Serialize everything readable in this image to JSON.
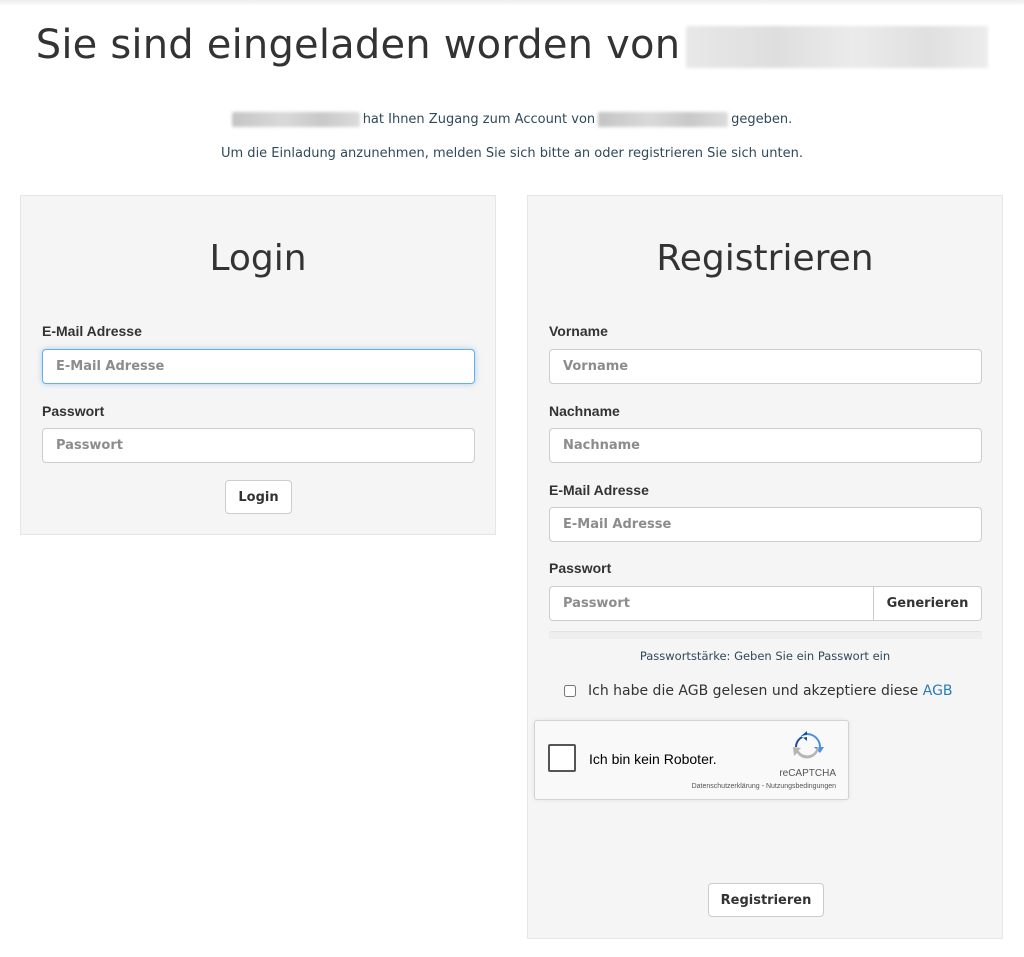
{
  "header": {
    "title": "Sie sind eingeladen worden von",
    "info_access": "hat Ihnen Zugang zum Account von",
    "info_given": "gegeben.",
    "info_instruction": "Um die Einladung anzunehmen, melden Sie sich bitte an oder registrieren Sie sich unten."
  },
  "login": {
    "title": "Login",
    "email_label": "E-Mail Adresse",
    "email_placeholder": "E-Mail Adresse",
    "password_label": "Passwort",
    "password_placeholder": "Passwort",
    "submit_label": "Login"
  },
  "register": {
    "title": "Registrieren",
    "firstname_label": "Vorname",
    "firstname_placeholder": "Vorname",
    "lastname_label": "Nachname",
    "lastname_placeholder": "Nachname",
    "email_label": "E-Mail Adresse",
    "email_placeholder": "E-Mail Adresse",
    "password_label": "Passwort",
    "password_placeholder": "Passwort",
    "generate_label": "Generieren",
    "strength_text": "Passwortstärke: Geben Sie ein Passwort ein",
    "agb_text": "Ich habe die AGB gelesen und akzeptiere diese",
    "agb_link": "AGB",
    "submit_label": "Registrieren"
  },
  "captcha": {
    "label": "Ich bin kein Roboter.",
    "brand": "reCAPTCHA",
    "privacy": "Datenschutzerklärung",
    "separator": " - ",
    "terms": "Nutzungsbedingungen"
  },
  "colors": {
    "link": "#2a7bb8",
    "panel_bg": "#f5f5f5",
    "focus_border": "#66afe9",
    "info_text": "#2f4a5a"
  }
}
